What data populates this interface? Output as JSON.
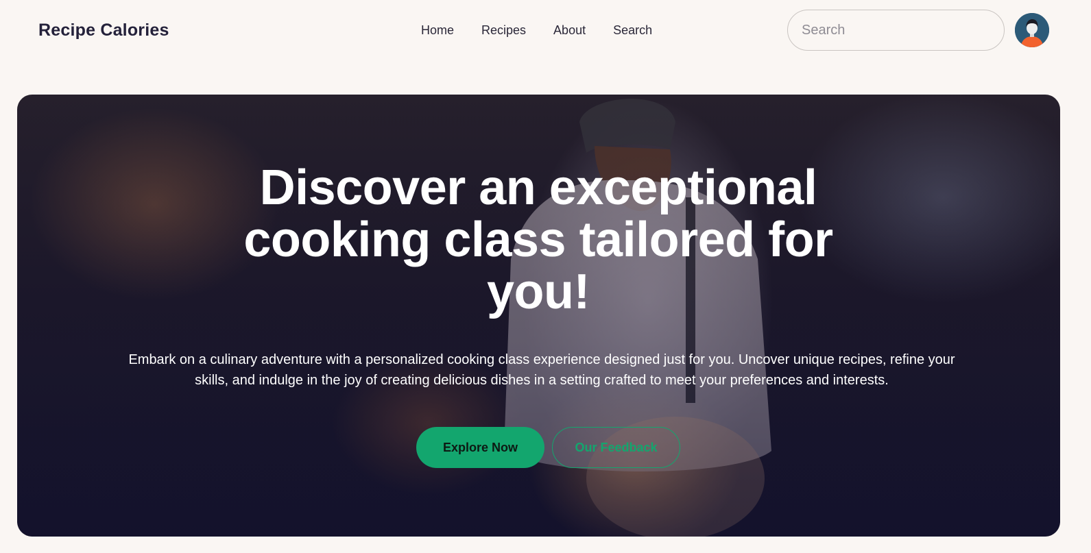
{
  "header": {
    "brand": "Recipe Calories",
    "nav": [
      {
        "label": "Home"
      },
      {
        "label": "Recipes"
      },
      {
        "label": "About"
      },
      {
        "label": "Search"
      }
    ],
    "search": {
      "placeholder": "Search",
      "value": ""
    },
    "avatar_icon": "user-avatar-icon"
  },
  "hero": {
    "title": "Discover an exceptional cooking class tailored for you!",
    "subtitle": "Embark on a culinary adventure with a personalized cooking class experience designed just for you. Uncover unique recipes, refine your skills, and indulge in the joy of creating delicious dishes in a setting crafted to meet your preferences and interests.",
    "primary_button": "Explore Now",
    "secondary_button": "Our Feedback"
  },
  "colors": {
    "background": "#faf6f3",
    "accent": "#13a66e",
    "text_dark": "#24213a"
  }
}
